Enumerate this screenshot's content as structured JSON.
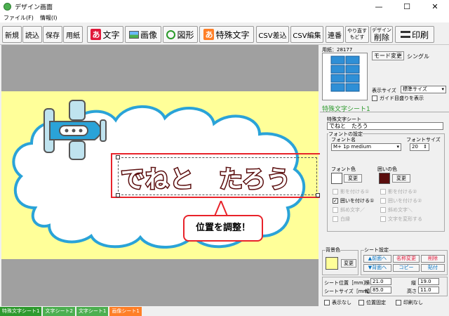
{
  "window": {
    "title": "デザイン画面",
    "min": "—",
    "max": "☐",
    "close": "✕"
  },
  "menu": {
    "file": "ファイル(F)",
    "info": "情報(I)"
  },
  "toolbar": {
    "new": "新規",
    "read": "読込",
    "save": "保存",
    "paper": "用紙",
    "text": "文字",
    "text_icon": "あ",
    "image": "画像",
    "shape": "図形",
    "special_text": "特殊文字",
    "special_icon": "あ",
    "csv_insert": "CSV差込",
    "csv_edit": "CSV編集",
    "numbering": "連番",
    "redo": "やり直す",
    "undo": "もどす",
    "design_delete_top": "デザイン",
    "design_delete": "削除",
    "print": "印刷"
  },
  "canvas": {
    "text": "でねと　たろう",
    "callout": "位置を調整！"
  },
  "panel": {
    "paper_label": "用紙：28177",
    "mode_button": "モード変更",
    "mode_value": "シングル",
    "display_size_label": "表示サイズ",
    "display_size_value": "標準サイズ",
    "guide_label": "ガイド目盛りを表示",
    "sheet_header": "特殊文字シート1",
    "sheet_group_label": "特殊文字シート",
    "sheet_text": "でねと　たろう",
    "font_group_label": "フォントの設定",
    "font_name_label": "フォント名",
    "font_name_value": "M+ 1p medium",
    "font_size_label": "フォントサイズ",
    "font_size_value": "20",
    "font_color_label": "フォント色",
    "outline_color_label": "囲いの色",
    "change": "変更",
    "font_color": "#ffffff",
    "outline_color": "#5a0d0d",
    "opt_shadow1": "影を付ける①",
    "opt_shadow2": "影を付ける②",
    "opt_outline1": "囲いを付ける①",
    "opt_outline2": "囲いを付ける②",
    "opt_italic_left": "斜め文字／",
    "opt_italic_right": "斜め文字＼",
    "opt_white": "白縁",
    "opt_deform": "文字を変形する",
    "bg_label": "背景色",
    "bg_color": "#ffff99",
    "bg_change": "変更",
    "sheet_settings_label": "シート設定",
    "front": "▲前面へ",
    "back": "▼背面へ",
    "rename": "名称変更",
    "copy": "コピー",
    "delete": "削除",
    "paste": "貼付",
    "pos_label": "シート位置［mm］",
    "width_pos_label": "横",
    "width_pos_value": "21.0",
    "height_pos_label": "縦",
    "height_pos_value": "19.0",
    "size_label": "シートサイズ［mm］",
    "w_label": "幅",
    "w_value": "85.0",
    "h_label": "高さ",
    "h_value": "11.0",
    "hide": "表示なし",
    "fix_pos": "位置固定",
    "no_print": "印刷なし"
  },
  "tabs": [
    {
      "label": "特殊文字シート1",
      "color": "#2e9a2e"
    },
    {
      "label": "文字シート2",
      "color": "#4caf50"
    },
    {
      "label": "文字シート1",
      "color": "#4caf50"
    },
    {
      "label": "画像シート1",
      "color": "#ff7f27"
    }
  ]
}
